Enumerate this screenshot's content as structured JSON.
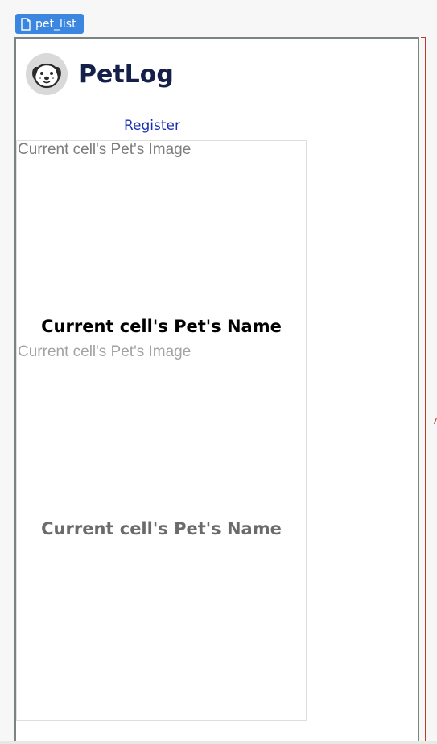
{
  "page_tab": {
    "label": "pet_list",
    "icon": "document-icon"
  },
  "header": {
    "app_name": "PetLog",
    "logo_icon": "dog-face-icon"
  },
  "register_link": {
    "label": "Register"
  },
  "repeating_group": {
    "cells": [
      {
        "image_placeholder": "Current cell's Pet's Image",
        "name_placeholder": "Current cell's Pet's Name"
      },
      {
        "image_placeholder": "Current cell's Pet's Image",
        "name_placeholder": "Current cell's Pet's Name"
      }
    ]
  },
  "ruler": {
    "label": "7"
  },
  "colors": {
    "tab_background": "#3b86e0",
    "app_name": "#14204a",
    "link": "#1a2fb5",
    "ruler": "#c0392b"
  }
}
